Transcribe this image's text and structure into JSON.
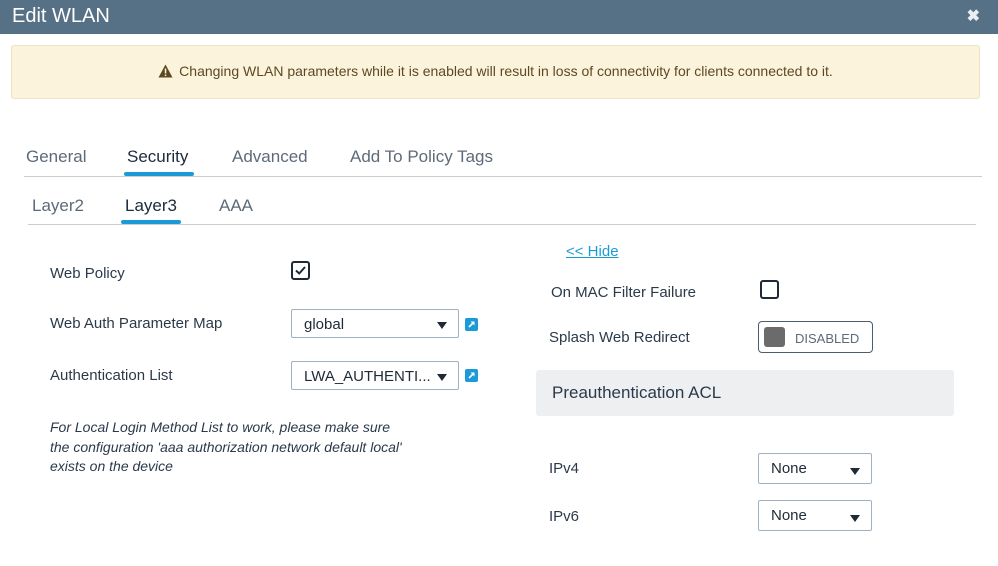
{
  "window": {
    "title": "Edit WLAN",
    "close_glyph": "✖"
  },
  "alert": {
    "icon": "warning-triangle-icon",
    "text": "Changing WLAN parameters while it is enabled will result in loss of connectivity for clients connected to it."
  },
  "main_tabs": [
    "General",
    "Security",
    "Advanced",
    "Add To Policy Tags"
  ],
  "main_tab_active": "Security",
  "sub_tabs": [
    "Layer2",
    "Layer3",
    "AAA"
  ],
  "sub_tab_active": "Layer3",
  "left": {
    "web_policy": {
      "label": "Web Policy",
      "checked": true
    },
    "web_auth_param_map": {
      "label": "Web Auth Parameter Map",
      "value": "global"
    },
    "authentication_list": {
      "label": "Authentication List",
      "value": "LWA_AUTHENTI..."
    },
    "note": {
      "line1": "For Local Login Method List to work, please make sure",
      "line2": "the configuration 'aaa authorization network default local'",
      "line3": "exists on the device"
    }
  },
  "right": {
    "hide_link": "<< Hide",
    "on_mac_filter_failure": {
      "label": "On MAC Filter Failure",
      "checked": false
    },
    "splash_web_redirect": {
      "label": "Splash Web Redirect",
      "toggle_text": "DISABLED"
    },
    "preauth_acl": {
      "title": "Preauthentication ACL",
      "ipv4": {
        "label": "IPv4",
        "value": "None"
      },
      "ipv6": {
        "label": "IPv6",
        "value": "None"
      }
    }
  },
  "colors": {
    "titlebar": "#567085",
    "accent": "#1a9bd7",
    "alert_bg": "#fcf3dd",
    "panel_bg": "#edeff1"
  }
}
